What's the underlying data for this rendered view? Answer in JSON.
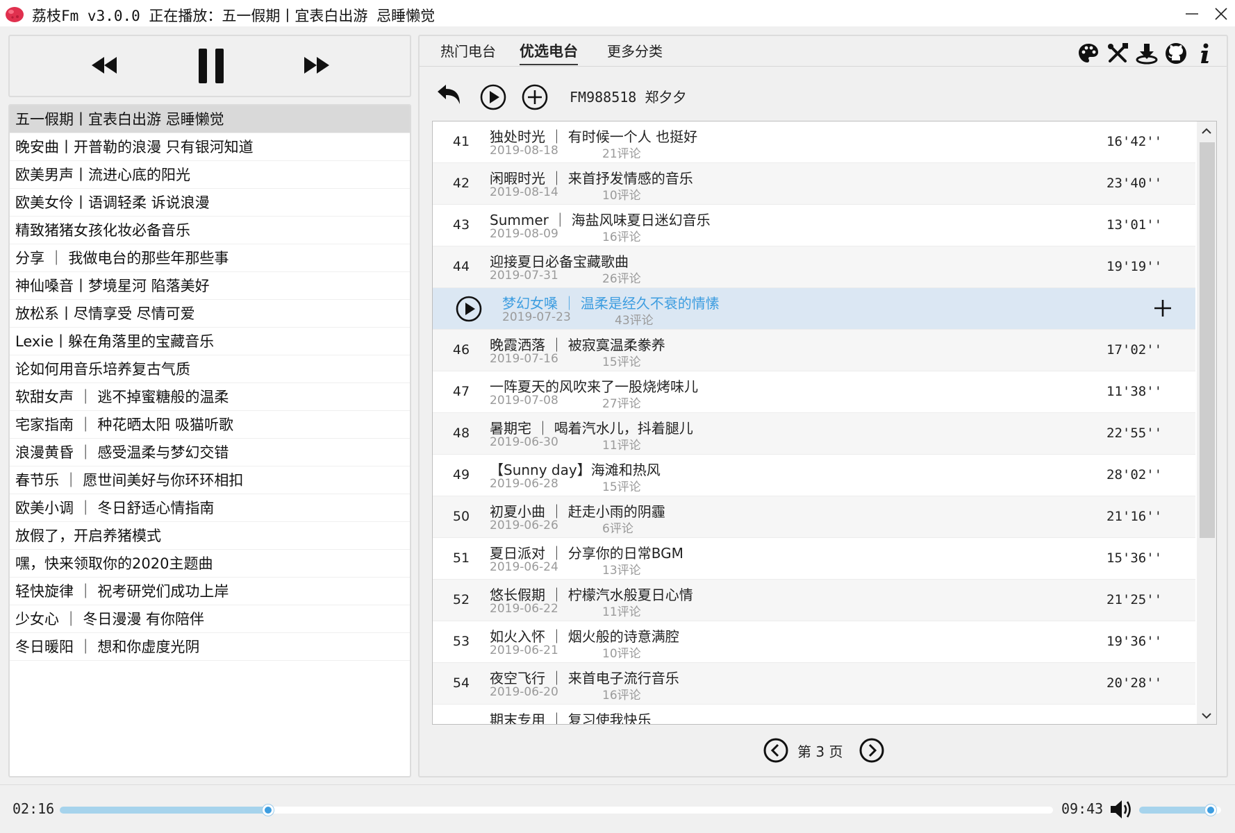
{
  "window": {
    "title": "荔枝Fm v3.0.0 正在播放：五一假期丨宜表白出游 忌睡懒觉",
    "minimize_icon": "minimize-icon",
    "close_icon": "close-icon"
  },
  "player": {
    "prev_icon": "rewind-icon",
    "pause_icon": "pause-icon",
    "next_icon": "fast-forward-icon"
  },
  "playlist": {
    "active_index": 0,
    "items": [
      "五一假期丨宜表白出游 忌睡懒觉",
      "晚安曲丨开普勒的浪漫 只有银河知道",
      "欧美男声丨流进心底的阳光",
      "欧美女伶丨语调轻柔 诉说浪漫",
      "精致猪猪女孩化妆必备音乐",
      "分享 ｜ 我做电台的那些年那些事",
      "神仙嗓音丨梦境星河 陷落美好",
      "放松系丨尽情享受 尽情可爱",
      "Lexie丨躲在角落里的宝藏音乐",
      "论如何用音乐培养复古气质",
      "软甜女声 ｜ 逃不掉蜜糖般的温柔",
      "宅家指南 ｜ 种花晒太阳 吸猫听歌",
      "浪漫黄昏 ｜ 感受温柔与梦幻交错",
      "春节乐 ｜ 愿世间美好与你环环相扣",
      "欧美小调 ｜ 冬日舒适心情指南",
      "放假了，开启养猪模式",
      "嘿，快来领取你的2020主题曲",
      "轻快旋律 ｜ 祝考研党们成功上岸",
      "少女心 ｜ 冬日漫漫 有你陪伴",
      "冬日暖阳 ｜ 想和你虚度光阴"
    ]
  },
  "tabs": {
    "hot": "热门电台",
    "featured": "优选电台",
    "more": "更多分类",
    "active": "featured"
  },
  "toolbar_icons": [
    "palette-icon",
    "tools-icon",
    "download-icon",
    "github-icon",
    "info-icon"
  ],
  "actions": {
    "back_icon": "back-arrow-icon",
    "play_all_icon": "play-circle-icon",
    "add_icon": "add-circle-icon",
    "station": "FM988518 郑夕夕"
  },
  "tracks": [
    {
      "num": "41",
      "title": "独处时光 ｜ 有时候一个人 也挺好",
      "date": "2019-08-18",
      "comments": "21评论",
      "duration": "16'42''"
    },
    {
      "num": "42",
      "title": "闲暇时光 ｜ 来首抒发情感的音乐",
      "date": "2019-08-14",
      "comments": "10评论",
      "duration": "23'40''"
    },
    {
      "num": "43",
      "title": "Summer ｜ 海盐风味夏日迷幻音乐",
      "date": "2019-08-09",
      "comments": "16评论",
      "duration": "13'01''"
    },
    {
      "num": "44",
      "title": "迎接夏日必备宝藏歌曲",
      "date": "2019-07-31",
      "comments": "26评论",
      "duration": "19'19''"
    },
    {
      "num": "",
      "title": "梦幻女嗓 ｜ 温柔是经久不衰的情愫",
      "date": "2019-07-23",
      "comments": "43评论",
      "duration": "",
      "selected": true
    },
    {
      "num": "46",
      "title": "晚霞洒落 ｜ 被寂寞温柔豢养",
      "date": "2019-07-16",
      "comments": "15评论",
      "duration": "17'02''"
    },
    {
      "num": "47",
      "title": "一阵夏天的风吹来了一股烧烤味儿",
      "date": "2019-07-08",
      "comments": "27评论",
      "duration": "11'38''"
    },
    {
      "num": "48",
      "title": "暑期宅 ｜ 喝着汽水儿，抖着腿儿",
      "date": "2019-06-30",
      "comments": "11评论",
      "duration": "22'55''"
    },
    {
      "num": "49",
      "title": "【Sunny day】海滩和热风",
      "date": "2019-06-28",
      "comments": "15评论",
      "duration": "28'02''"
    },
    {
      "num": "50",
      "title": "初夏小曲 ｜ 赶走小雨的阴霾",
      "date": "2019-06-26",
      "comments": "6评论",
      "duration": "21'16''"
    },
    {
      "num": "51",
      "title": "夏日派对 ｜ 分享你的日常BGM",
      "date": "2019-06-24",
      "comments": "13评论",
      "duration": "15'36''"
    },
    {
      "num": "52",
      "title": "悠长假期 ｜ 柠檬汽水般夏日心情",
      "date": "2019-06-22",
      "comments": "11评论",
      "duration": "21'25''"
    },
    {
      "num": "53",
      "title": "如火入怀 ｜ 烟火般的诗意满腔",
      "date": "2019-06-21",
      "comments": "10评论",
      "duration": "19'36''"
    },
    {
      "num": "54",
      "title": "夜空飞行 ｜ 来首电子流行音乐",
      "date": "2019-06-20",
      "comments": "16评论",
      "duration": "20'28''"
    },
    {
      "num": "",
      "title": "期末专用 ｜ 复习使我快乐",
      "date": "",
      "comments": "",
      "duration": ""
    }
  ],
  "pager": {
    "label": "第 3 页",
    "prev_icon": "chevron-left-circle-icon",
    "next_icon": "chevron-right-circle-icon"
  },
  "progress": {
    "current": "02:16",
    "total": "09:43",
    "fraction": 0.21,
    "volume_fraction": 0.87,
    "volume_icon": "volume-icon"
  },
  "colors": {
    "accent": "#3d9de0",
    "selected_row": "#dbe7f3",
    "progress_fill": "#a6d3ec"
  }
}
